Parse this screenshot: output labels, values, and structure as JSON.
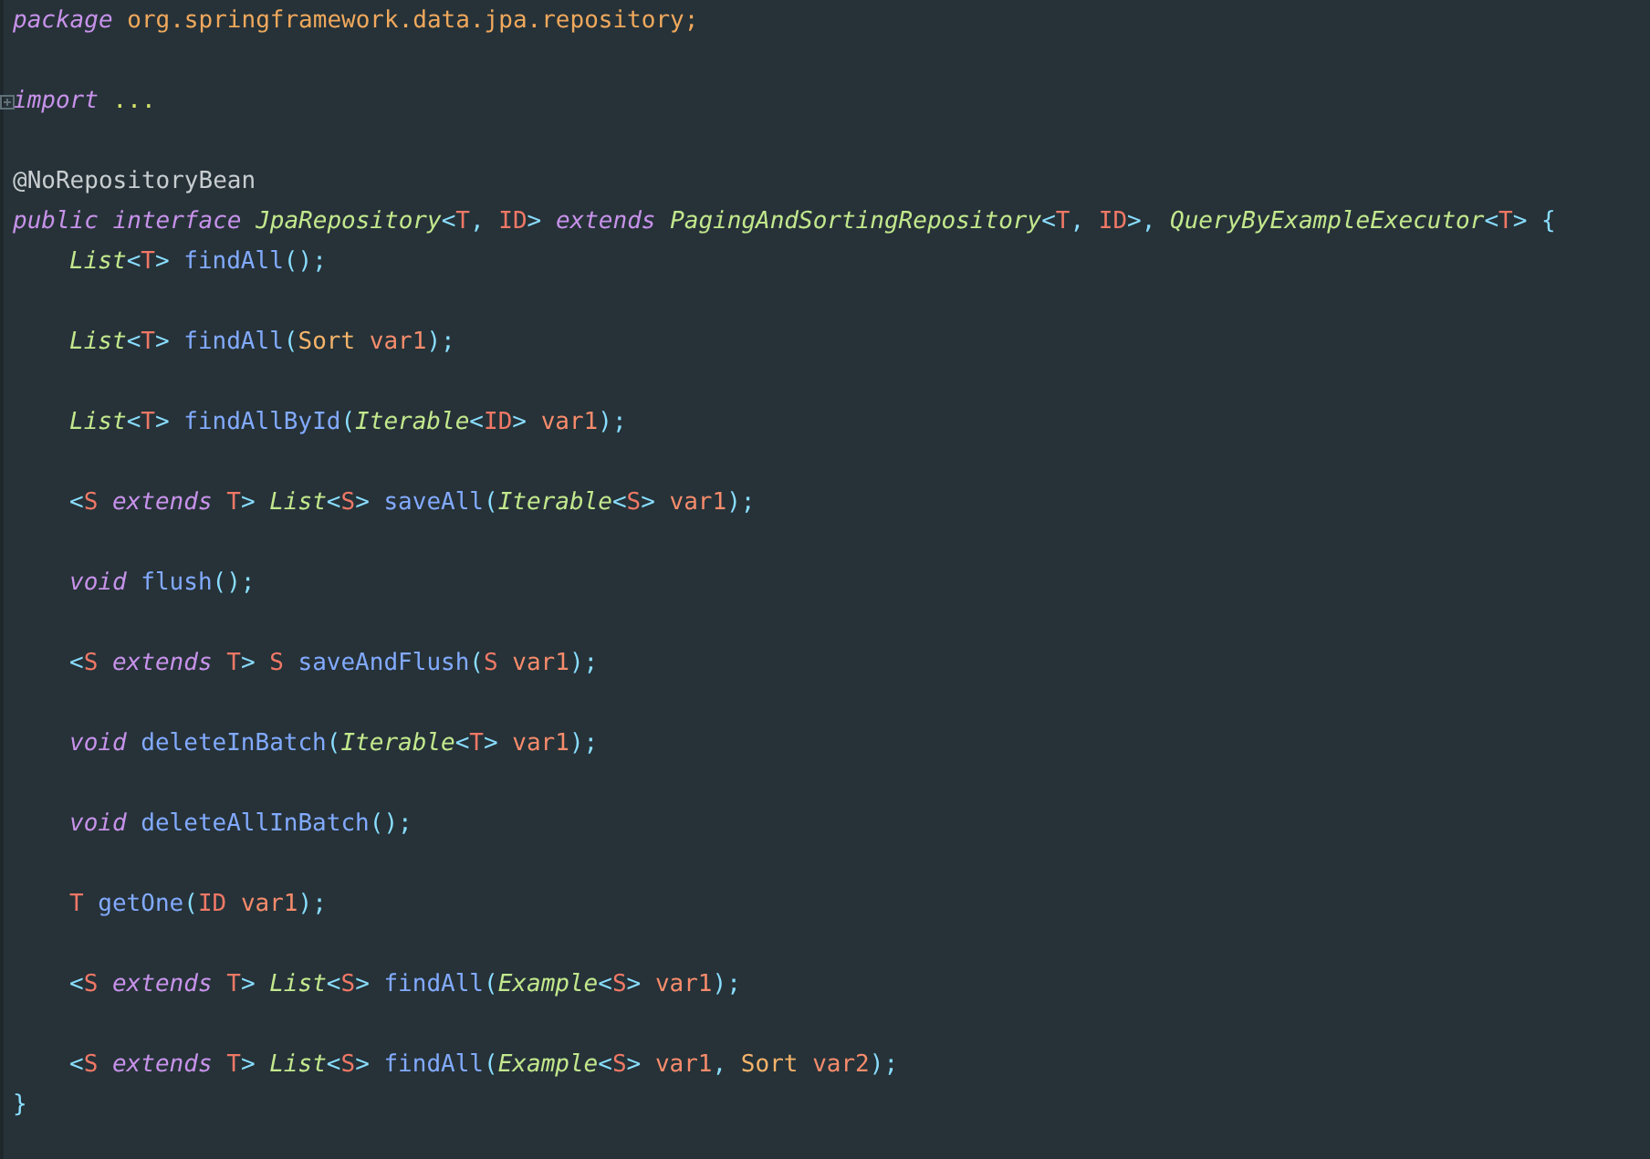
{
  "editor": {
    "blocks": [
      {
        "lines": [
          {
            "kind": "code",
            "tokens": [
              {
                "kind": "kw",
                "text": "package "
              },
              {
                "kind": "pkg",
                "text": "org.springframework.data.jpa.repository;"
              }
            ]
          }
        ]
      },
      {
        "lines": [
          {
            "kind": "folded",
            "tokens": [
              {
                "kind": "kw",
                "text": "import "
              },
              {
                "kind": "fold",
                "text": "..."
              }
            ]
          }
        ]
      },
      {
        "lines": [
          {
            "kind": "code",
            "tokens": [
              {
                "kind": "anno",
                "text": "@NoRepositoryBean"
              }
            ]
          },
          {
            "kind": "code",
            "tokens": [
              {
                "kind": "kw",
                "text": "public interface "
              },
              {
                "kind": "type",
                "text": "JpaRepository"
              },
              {
                "kind": "punct",
                "text": "<"
              },
              {
                "kind": "tparam",
                "text": "T"
              },
              {
                "kind": "punct",
                "text": ", "
              },
              {
                "kind": "tparam",
                "text": "ID"
              },
              {
                "kind": "punct",
                "text": "> "
              },
              {
                "kind": "kw",
                "text": "extends "
              },
              {
                "kind": "type",
                "text": "PagingAndSortingRepository"
              },
              {
                "kind": "punct",
                "text": "<"
              },
              {
                "kind": "tparam",
                "text": "T"
              },
              {
                "kind": "punct",
                "text": ", "
              },
              {
                "kind": "tparam",
                "text": "ID"
              },
              {
                "kind": "punct",
                "text": ">, "
              },
              {
                "kind": "type",
                "text": "QueryByExampleExecutor"
              },
              {
                "kind": "punct",
                "text": "<"
              },
              {
                "kind": "tparam",
                "text": "T"
              },
              {
                "kind": "punct",
                "text": "> {"
              }
            ],
            "body": [
              {
                "lines": [
                  {
                    "kind": "code",
                    "tokens": [
                      {
                        "kind": "type",
                        "text": "List"
                      },
                      {
                        "kind": "punct",
                        "text": "<"
                      },
                      {
                        "kind": "tparam",
                        "text": "T"
                      },
                      {
                        "kind": "punct",
                        "text": "> "
                      },
                      {
                        "kind": "method",
                        "text": "findAll"
                      },
                      {
                        "kind": "punct",
                        "text": "();"
                      }
                    ]
                  }
                ]
              },
              {
                "lines": [
                  {
                    "kind": "code",
                    "tokens": [
                      {
                        "kind": "type",
                        "text": "List"
                      },
                      {
                        "kind": "punct",
                        "text": "<"
                      },
                      {
                        "kind": "tparam",
                        "text": "T"
                      },
                      {
                        "kind": "punct",
                        "text": "> "
                      },
                      {
                        "kind": "method",
                        "text": "findAll"
                      },
                      {
                        "kind": "punct",
                        "text": "("
                      },
                      {
                        "kind": "cls",
                        "text": "Sort "
                      },
                      {
                        "kind": "param",
                        "text": "var1"
                      },
                      {
                        "kind": "punct",
                        "text": ");"
                      }
                    ]
                  }
                ]
              },
              {
                "lines": [
                  {
                    "kind": "code",
                    "tokens": [
                      {
                        "kind": "type",
                        "text": "List"
                      },
                      {
                        "kind": "punct",
                        "text": "<"
                      },
                      {
                        "kind": "tparam",
                        "text": "T"
                      },
                      {
                        "kind": "punct",
                        "text": "> "
                      },
                      {
                        "kind": "method",
                        "text": "findAllById"
                      },
                      {
                        "kind": "punct",
                        "text": "("
                      },
                      {
                        "kind": "type",
                        "text": "Iterable"
                      },
                      {
                        "kind": "punct",
                        "text": "<"
                      },
                      {
                        "kind": "tparam",
                        "text": "ID"
                      },
                      {
                        "kind": "punct",
                        "text": "> "
                      },
                      {
                        "kind": "param",
                        "text": "var1"
                      },
                      {
                        "kind": "punct",
                        "text": ");"
                      }
                    ]
                  }
                ]
              },
              {
                "lines": [
                  {
                    "kind": "code",
                    "tokens": [
                      {
                        "kind": "punct",
                        "text": "<"
                      },
                      {
                        "kind": "tparam",
                        "text": "S "
                      },
                      {
                        "kind": "kw",
                        "text": "extends "
                      },
                      {
                        "kind": "tparam",
                        "text": "T"
                      },
                      {
                        "kind": "punct",
                        "text": "> "
                      },
                      {
                        "kind": "type",
                        "text": "List"
                      },
                      {
                        "kind": "punct",
                        "text": "<"
                      },
                      {
                        "kind": "tparam",
                        "text": "S"
                      },
                      {
                        "kind": "punct",
                        "text": "> "
                      },
                      {
                        "kind": "method",
                        "text": "saveAll"
                      },
                      {
                        "kind": "punct",
                        "text": "("
                      },
                      {
                        "kind": "type",
                        "text": "Iterable"
                      },
                      {
                        "kind": "punct",
                        "text": "<"
                      },
                      {
                        "kind": "tparam",
                        "text": "S"
                      },
                      {
                        "kind": "punct",
                        "text": "> "
                      },
                      {
                        "kind": "param",
                        "text": "var1"
                      },
                      {
                        "kind": "punct",
                        "text": ");"
                      }
                    ]
                  }
                ]
              },
              {
                "lines": [
                  {
                    "kind": "code",
                    "tokens": [
                      {
                        "kind": "kw",
                        "text": "void "
                      },
                      {
                        "kind": "method",
                        "text": "flush"
                      },
                      {
                        "kind": "punct",
                        "text": "();"
                      }
                    ]
                  }
                ]
              },
              {
                "lines": [
                  {
                    "kind": "code",
                    "tokens": [
                      {
                        "kind": "punct",
                        "text": "<"
                      },
                      {
                        "kind": "tparam",
                        "text": "S "
                      },
                      {
                        "kind": "kw",
                        "text": "extends "
                      },
                      {
                        "kind": "tparam",
                        "text": "T"
                      },
                      {
                        "kind": "punct",
                        "text": "> "
                      },
                      {
                        "kind": "tparam",
                        "text": "S "
                      },
                      {
                        "kind": "method",
                        "text": "saveAndFlush"
                      },
                      {
                        "kind": "punct",
                        "text": "("
                      },
                      {
                        "kind": "tparam",
                        "text": "S "
                      },
                      {
                        "kind": "param",
                        "text": "var1"
                      },
                      {
                        "kind": "punct",
                        "text": ");"
                      }
                    ]
                  }
                ]
              },
              {
                "lines": [
                  {
                    "kind": "code",
                    "tokens": [
                      {
                        "kind": "kw",
                        "text": "void "
                      },
                      {
                        "kind": "method",
                        "text": "deleteInBatch"
                      },
                      {
                        "kind": "punct",
                        "text": "("
                      },
                      {
                        "kind": "type",
                        "text": "Iterable"
                      },
                      {
                        "kind": "punct",
                        "text": "<"
                      },
                      {
                        "kind": "tparam",
                        "text": "T"
                      },
                      {
                        "kind": "punct",
                        "text": "> "
                      },
                      {
                        "kind": "param",
                        "text": "var1"
                      },
                      {
                        "kind": "punct",
                        "text": ");"
                      }
                    ]
                  }
                ]
              },
              {
                "lines": [
                  {
                    "kind": "code",
                    "tokens": [
                      {
                        "kind": "kw",
                        "text": "void "
                      },
                      {
                        "kind": "method",
                        "text": "deleteAllInBatch"
                      },
                      {
                        "kind": "punct",
                        "text": "();"
                      }
                    ]
                  }
                ]
              },
              {
                "lines": [
                  {
                    "kind": "code",
                    "tokens": [
                      {
                        "kind": "tparam",
                        "text": "T "
                      },
                      {
                        "kind": "method",
                        "text": "getOne"
                      },
                      {
                        "kind": "punct",
                        "text": "("
                      },
                      {
                        "kind": "tparam",
                        "text": "ID "
                      },
                      {
                        "kind": "param",
                        "text": "var1"
                      },
                      {
                        "kind": "punct",
                        "text": ");"
                      }
                    ]
                  }
                ]
              },
              {
                "lines": [
                  {
                    "kind": "code",
                    "tokens": [
                      {
                        "kind": "punct",
                        "text": "<"
                      },
                      {
                        "kind": "tparam",
                        "text": "S "
                      },
                      {
                        "kind": "kw",
                        "text": "extends "
                      },
                      {
                        "kind": "tparam",
                        "text": "T"
                      },
                      {
                        "kind": "punct",
                        "text": "> "
                      },
                      {
                        "kind": "type",
                        "text": "List"
                      },
                      {
                        "kind": "punct",
                        "text": "<"
                      },
                      {
                        "kind": "tparam",
                        "text": "S"
                      },
                      {
                        "kind": "punct",
                        "text": "> "
                      },
                      {
                        "kind": "method",
                        "text": "findAll"
                      },
                      {
                        "kind": "punct",
                        "text": "("
                      },
                      {
                        "kind": "type",
                        "text": "Example"
                      },
                      {
                        "kind": "punct",
                        "text": "<"
                      },
                      {
                        "kind": "tparam",
                        "text": "S"
                      },
                      {
                        "kind": "punct",
                        "text": "> "
                      },
                      {
                        "kind": "param",
                        "text": "var1"
                      },
                      {
                        "kind": "punct",
                        "text": ");"
                      }
                    ]
                  }
                ]
              },
              {
                "lines": [
                  {
                    "kind": "code",
                    "tokens": [
                      {
                        "kind": "punct",
                        "text": "<"
                      },
                      {
                        "kind": "tparam",
                        "text": "S "
                      },
                      {
                        "kind": "kw",
                        "text": "extends "
                      },
                      {
                        "kind": "tparam",
                        "text": "T"
                      },
                      {
                        "kind": "punct",
                        "text": "> "
                      },
                      {
                        "kind": "type",
                        "text": "List"
                      },
                      {
                        "kind": "punct",
                        "text": "<"
                      },
                      {
                        "kind": "tparam",
                        "text": "S"
                      },
                      {
                        "kind": "punct",
                        "text": "> "
                      },
                      {
                        "kind": "method",
                        "text": "findAll"
                      },
                      {
                        "kind": "punct",
                        "text": "("
                      },
                      {
                        "kind": "type",
                        "text": "Example"
                      },
                      {
                        "kind": "punct",
                        "text": "<"
                      },
                      {
                        "kind": "tparam",
                        "text": "S"
                      },
                      {
                        "kind": "punct",
                        "text": "> "
                      },
                      {
                        "kind": "param",
                        "text": "var1"
                      },
                      {
                        "kind": "punct",
                        "text": ", "
                      },
                      {
                        "kind": "cls",
                        "text": "Sort "
                      },
                      {
                        "kind": "param",
                        "text": "var2"
                      },
                      {
                        "kind": "punct",
                        "text": ");"
                      }
                    ]
                  }
                ]
              }
            ]
          },
          {
            "kind": "code",
            "tokens": [
              {
                "kind": "punct",
                "text": "}"
              }
            ]
          }
        ]
      }
    ]
  }
}
